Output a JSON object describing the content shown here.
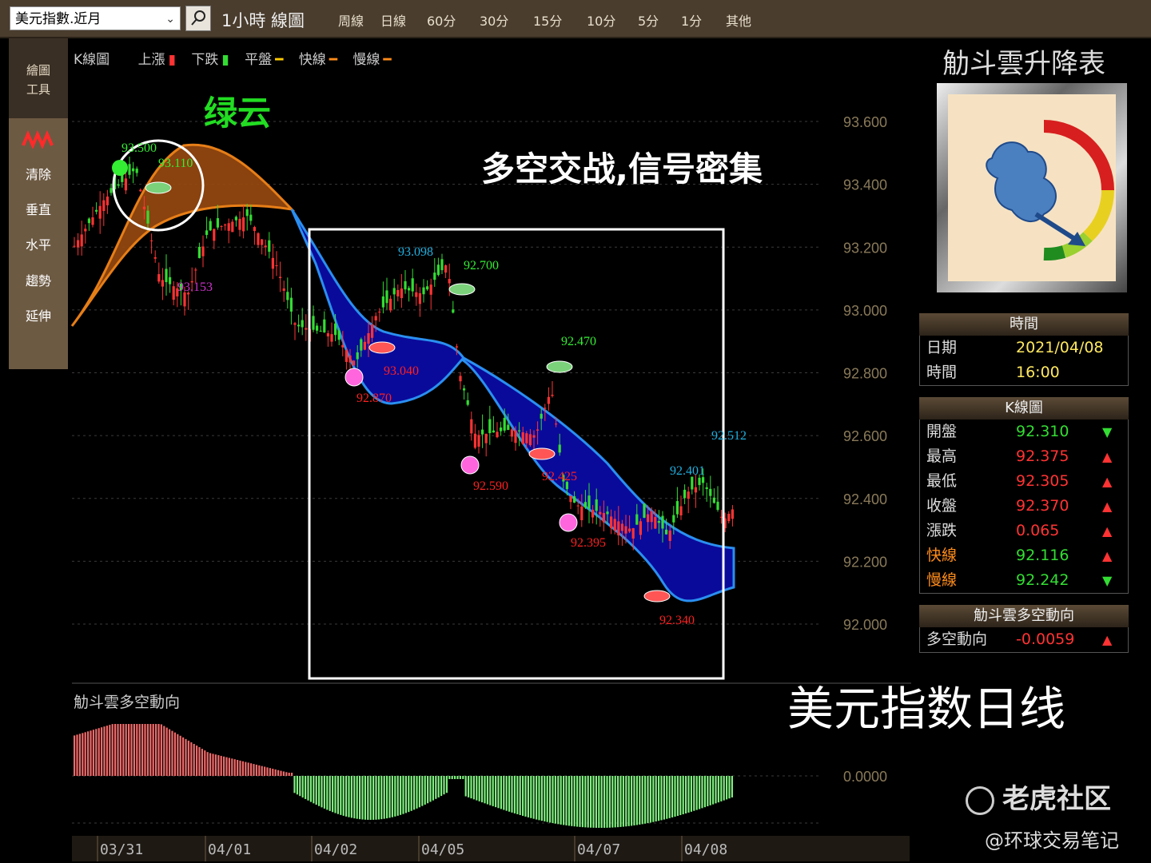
{
  "toolbar": {
    "symbol": "美元指數.近月",
    "period": "1小時 線圖",
    "periods": [
      "周線",
      "日線",
      "60分",
      "30分",
      "15分",
      "10分",
      "5分",
      "1分",
      "其他"
    ]
  },
  "left_tools": {
    "header": [
      "繪圖",
      "工具"
    ],
    "items": [
      "清除",
      "垂直",
      "水平",
      "趨勢",
      "延伸"
    ]
  },
  "legend": {
    "title": "K線圖",
    "up": "上漲",
    "down": "下跌",
    "flat": "平盤",
    "fast": "快線",
    "slow": "慢線"
  },
  "annotations": {
    "green_cloud": "绿云",
    "headline": "多空交战,信号密集",
    "bottom_caption": "美元指数日线",
    "watermark": "老虎社区",
    "author": "@环球交易笔记"
  },
  "indicator_title": "觔斗雲多空動向",
  "price_labels": [
    {
      "text": "93.500",
      "color": "#33ee33"
    },
    {
      "text": "93.110",
      "color": "#33ee33"
    },
    {
      "text": "93.153",
      "color": "#cc33cc"
    },
    {
      "text": "93.098",
      "color": "#1fb0e0"
    },
    {
      "text": "92.700",
      "color": "#33ee33"
    },
    {
      "text": "93.040",
      "color": "#ff2020"
    },
    {
      "text": "92.870",
      "color": "#ff2020"
    },
    {
      "text": "92.470",
      "color": "#33ee33"
    },
    {
      "text": "92.590",
      "color": "#ff2020"
    },
    {
      "text": "92.425",
      "color": "#ff2020"
    },
    {
      "text": "92.395",
      "color": "#ff2020"
    },
    {
      "text": "92.512",
      "color": "#1fb0e0"
    },
    {
      "text": "92.401",
      "color": "#1fb0e0"
    },
    {
      "text": "92.340",
      "color": "#ff2020"
    }
  ],
  "chart_data": {
    "type": "candlestick",
    "y_ticks": [
      "93.600",
      "93.400",
      "93.200",
      "93.000",
      "92.800",
      "92.600",
      "92.400",
      "92.200",
      "92.000"
    ],
    "ylim": [
      92.0,
      93.6
    ],
    "x_labels": [
      "03/31",
      "04/01",
      "04/02",
      "04/05",
      "04/07",
      "04/08"
    ],
    "indicator_zero_label": "0.0000",
    "series": [
      {
        "name": "快線",
        "color": "#ff8c1a"
      },
      {
        "name": "慢線",
        "color": "#ff8c1a"
      }
    ]
  },
  "panel": {
    "title": "觔斗雲升降表",
    "time_header": "時間",
    "date_label": "日期",
    "date": "2021/04/08",
    "time_label": "時間",
    "time": "16:00",
    "kline_header": "K線圖",
    "rows": [
      {
        "label": "開盤",
        "value": "92.310",
        "dir": "▼",
        "color": "#33dd33",
        "lcolor": "#dddddd"
      },
      {
        "label": "最高",
        "value": "92.375",
        "dir": "▲",
        "color": "#ff3333",
        "lcolor": "#dddddd"
      },
      {
        "label": "最低",
        "value": "92.305",
        "dir": "▲",
        "color": "#ff3333",
        "lcolor": "#dddddd"
      },
      {
        "label": "收盤",
        "value": "92.370",
        "dir": "▲",
        "color": "#ff3333",
        "lcolor": "#dddddd"
      },
      {
        "label": "漲跌",
        "value": "0.065",
        "dir": "▲",
        "color": "#ff3333",
        "lcolor": "#dddddd"
      },
      {
        "label": "快線",
        "value": "92.116",
        "dir": "▲",
        "color": "#33dd33",
        "lcolor": "#ff8c1a"
      },
      {
        "label": "慢線",
        "value": "92.242",
        "dir": "▼",
        "color": "#33dd33",
        "lcolor": "#ff8c1a"
      }
    ],
    "trend_header": "觔斗雲多空動向",
    "trend_label": "多空動向",
    "trend_value": "-0.0059",
    "trend_dir": "▲"
  },
  "colors": {
    "up": "#ff3333",
    "down": "#33dd33",
    "band_bear": "#0a0a9a",
    "band_bull": "#9a4a10"
  }
}
